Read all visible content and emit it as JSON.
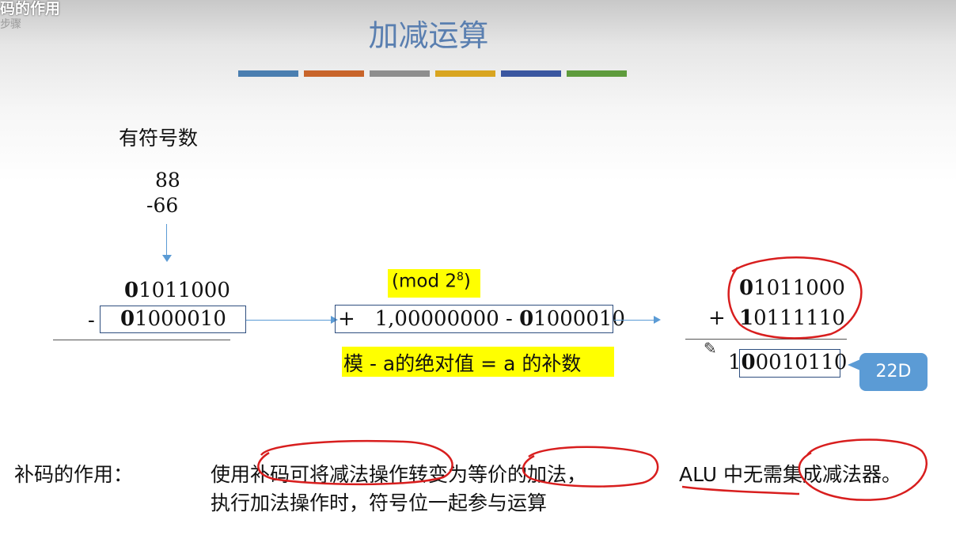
{
  "overlay": {
    "caption": "码的作用",
    "sub_caption": "步骤"
  },
  "slide": {
    "title": "加减运算",
    "color_bars": [
      "#4a7eb0",
      "#c8642a",
      "#8e8e8e",
      "#d9a520",
      "#3a56a0",
      "#5e9b3c"
    ]
  },
  "left": {
    "heading": "有符号数",
    "num1": "88",
    "num2": "-66",
    "bin1_first": "0",
    "bin1_rest": "1011000",
    "minus_sign": "-",
    "bin2_first": "0",
    "bin2_rest": "1000010"
  },
  "middle": {
    "mod_prefix": "(mod 2",
    "mod_exp": "8",
    "mod_suffix": ")",
    "calc_plus": "+",
    "calc_mod": "1,00000000",
    "calc_sep": "-",
    "calc_first": "0",
    "calc_rest": "1000010",
    "rule": "模 - a的绝对值 = a 的补数"
  },
  "right": {
    "r1_first": "0",
    "r1_rest": "1011000",
    "plus_sign": "+",
    "r2_first": "1",
    "r2_rest": "0111110",
    "carry": "1",
    "r3_first": "0",
    "r3_rest": "0010110",
    "callout": "22D"
  },
  "bottom": {
    "label": "补码的作用：",
    "line1": "使用补码可将减法操作转变为等价的加法，",
    "alu_line": "ALU 中无需集成减法器。",
    "line2": "执行加法操作时，符号位一起参与运算"
  },
  "colors": {
    "title": "#5a7fb0",
    "highlight": "#ffff00",
    "arrow": "#5b9bd5",
    "ink": "#d81e1e"
  }
}
